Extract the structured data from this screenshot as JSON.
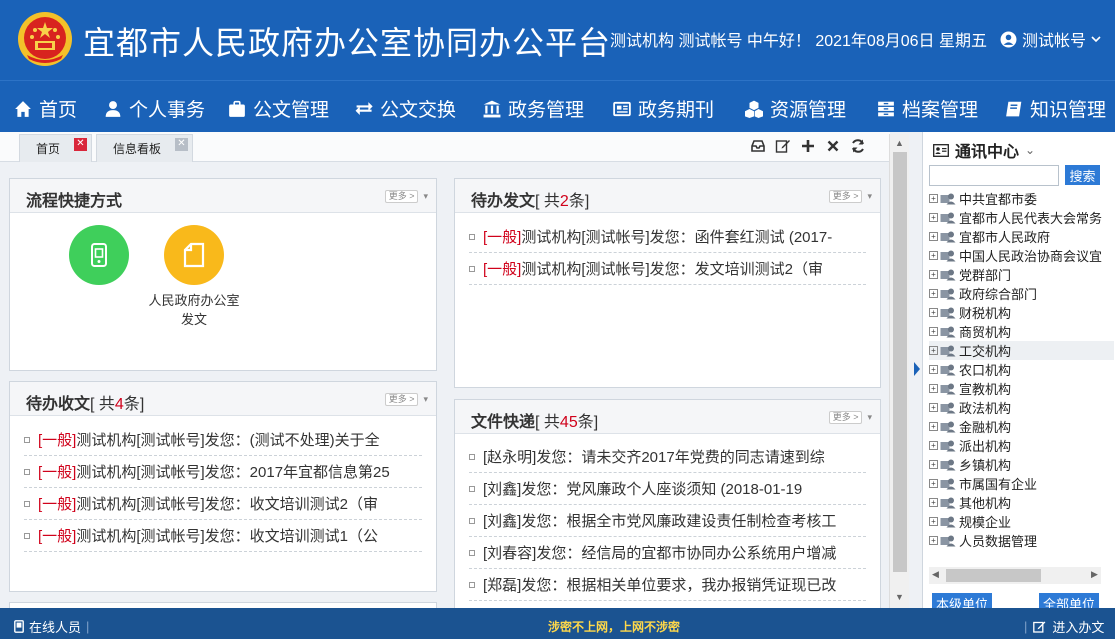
{
  "header": {
    "title": "宜都市人民政府办公室协同办公平台",
    "greeting": "测试机构 测试帐号 中午好！ 2021年08月06日 星期五",
    "user": "测试帐号"
  },
  "nav": [
    {
      "label": "首页",
      "icon": "home-icon"
    },
    {
      "label": "个人事务",
      "icon": "user-icon"
    },
    {
      "label": "公文管理",
      "icon": "briefcase-icon"
    },
    {
      "label": "公文交换",
      "icon": "exchange-icon"
    },
    {
      "label": "政务管理",
      "icon": "bank-icon"
    },
    {
      "label": "政务期刊",
      "icon": "newspaper-icon"
    },
    {
      "label": "资源管理",
      "icon": "cubes-icon"
    },
    {
      "label": "档案管理",
      "icon": "archive-icon"
    },
    {
      "label": "知识管理",
      "icon": "book-icon"
    }
  ],
  "tabs": [
    {
      "label": "首页"
    },
    {
      "label": "信息看板"
    }
  ],
  "panels": {
    "shortcuts": {
      "title": "流程快捷方式",
      "more": "更多 >",
      "items": [
        {
          "label": "",
          "color": "#3fcf5b",
          "icon": "phone-icon"
        },
        {
          "label": "人民政府办公室发文",
          "color": "#f9b91b",
          "icon": "document-icon"
        }
      ]
    },
    "inbox": {
      "title": "待办收文",
      "count_prefix": "[ 共",
      "count": "4",
      "count_suffix": "条]",
      "more": "更多 >",
      "items": [
        {
          "tag": "[一般]",
          "text": "测试机构[测试帐号]发您：(测试不处理)关于全"
        },
        {
          "tag": "[一般]",
          "text": "测试机构[测试帐号]发您：2017年宜都信息第25"
        },
        {
          "tag": "[一般]",
          "text": "测试机构[测试帐号]发您：收文培训测试2（审"
        },
        {
          "tag": "[一般]",
          "text": "测试机构[测试帐号]发您：收文培训测试1（公"
        }
      ]
    },
    "outbox": {
      "title": "待办发文",
      "count_prefix": "[ 共",
      "count": "2",
      "count_suffix": "条]",
      "more": "更多 >",
      "items": [
        {
          "tag": "[一般]",
          "text": "测试机构[测试帐号]发您：函件套红测试 (2017-"
        },
        {
          "tag": "[一般]",
          "text": "测试机构[测试帐号]发您：发文培训测试2（审"
        }
      ]
    },
    "express": {
      "title": "文件快递",
      "count_prefix": "[ 共",
      "count": "45",
      "count_suffix": "条]",
      "more": "更多 >",
      "items": [
        {
          "text": "[赵永明]发您：请未交齐2017年党费的同志请速到综"
        },
        {
          "text": "[刘鑫]发您：党风廉政个人座谈须知 (2018-01-19"
        },
        {
          "text": "[刘鑫]发您：根据全市党风廉政建设责任制检查考核工"
        },
        {
          "text": "[刘春容]发您：经信局的宜都市协同办公系统用户增减"
        },
        {
          "text": "[郑磊]发您：根据相关单位要求，我办报销凭证现已改"
        }
      ]
    }
  },
  "sidebar": {
    "title": "通讯中心",
    "search_placeholder": "",
    "search_button": "搜索",
    "tree": [
      "中共宜都市委",
      "宜都市人民代表大会常务",
      "宜都市人民政府",
      "中国人民政治协商会议宜",
      "党群部门",
      "政府综合部门",
      "财税机构",
      "商贸机构",
      "工交机构",
      "农口机构",
      "宣教机构",
      "政法机构",
      "金融机构",
      "派出机构",
      "乡镇机构",
      "市属国有企业",
      "其他机构",
      "规模企业",
      "人员数据管理"
    ],
    "highlighted": "工交机构",
    "btn_local": "本级单位",
    "btn_all": "全部单位"
  },
  "footer": {
    "online": "在线人员",
    "notice": "涉密不上网，上网不涉密",
    "enter": "进入办文"
  },
  "colors": {
    "brand": "#1a62b8",
    "footer": "#1b5391",
    "accent_red": "#d0021b",
    "button_blue": "#2d7ad6"
  }
}
